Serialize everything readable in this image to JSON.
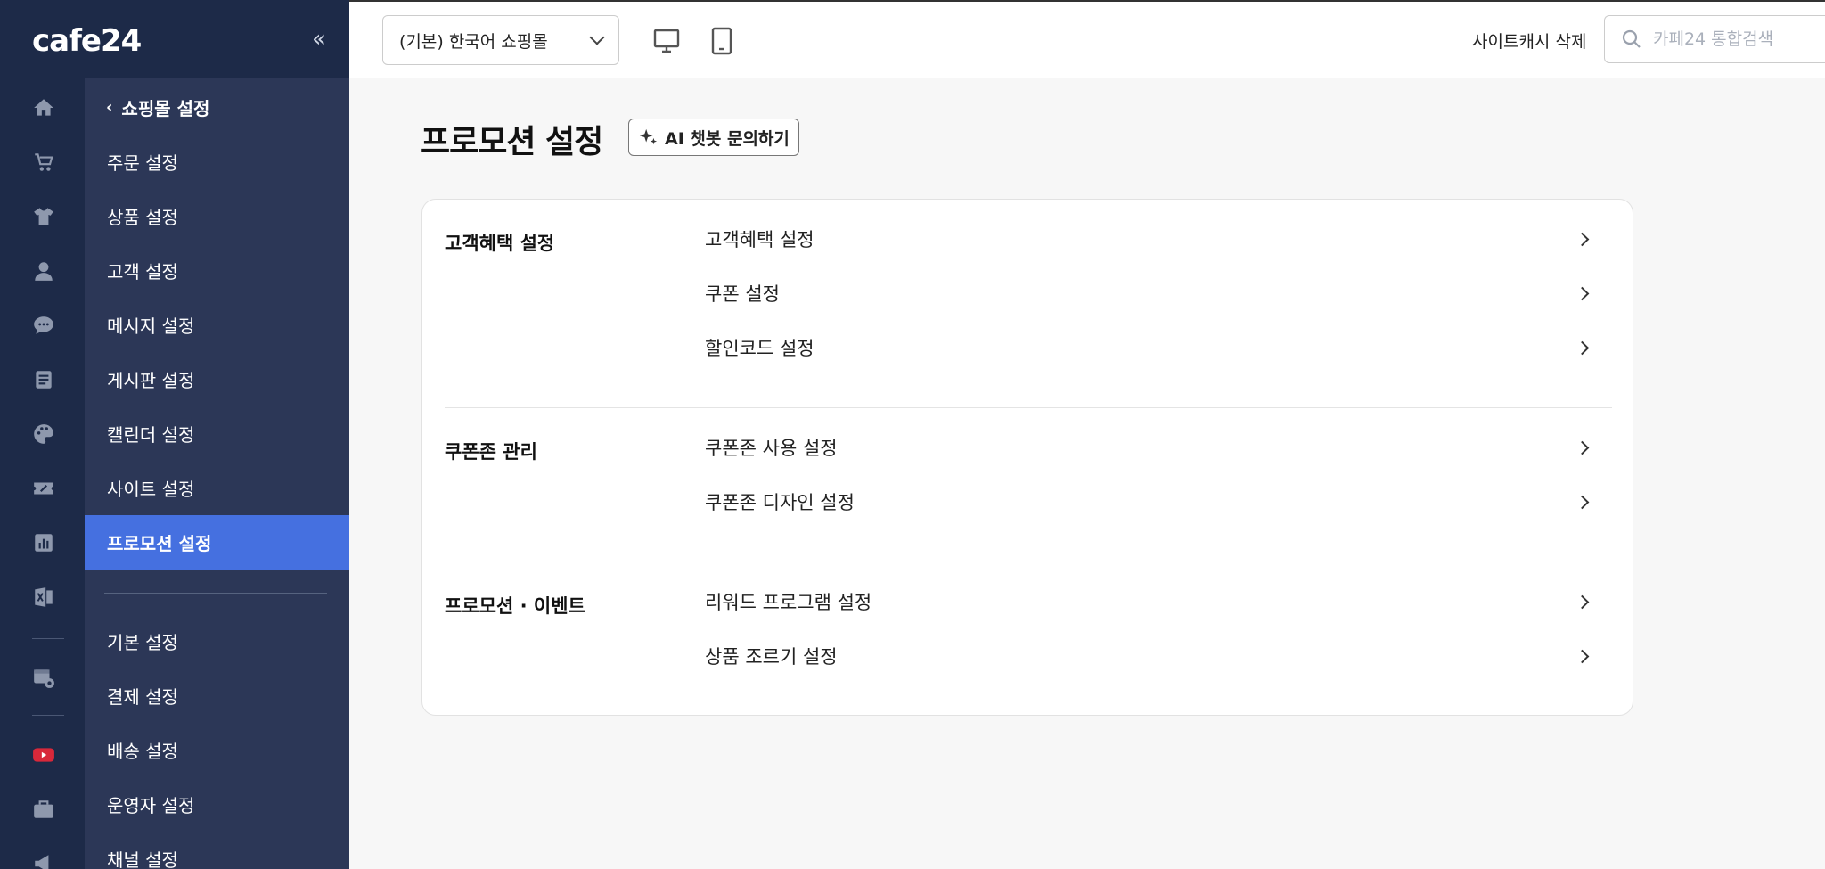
{
  "app": {
    "logo": "cafe24",
    "collapse_icon": "«"
  },
  "rail_icons": [
    "home-icon",
    "cart-icon",
    "tshirt-icon",
    "person-icon",
    "chat-icon",
    "document-icon",
    "palette-icon",
    "coupon-icon",
    "chart-icon",
    "excel-icon",
    "calendar-gear-icon",
    "youtube-icon",
    "briefcase-icon",
    "megaphone-icon"
  ],
  "submenu": {
    "back_label": "쇼핑몰 설정",
    "items": [
      {
        "label": "주문 설정"
      },
      {
        "label": "상품 설정"
      },
      {
        "label": "고객 설정"
      },
      {
        "label": "메시지 설정"
      },
      {
        "label": "게시판 설정"
      },
      {
        "label": "캘린더 설정"
      },
      {
        "label": "사이트 설정"
      },
      {
        "label": "프로모션 설정",
        "active": true
      }
    ],
    "items2": [
      {
        "label": "기본 설정"
      },
      {
        "label": "결제 설정"
      },
      {
        "label": "배송 설정"
      },
      {
        "label": "운영자 설정"
      },
      {
        "label": "채널 설정"
      }
    ]
  },
  "topbar": {
    "mall_select": "(기본) 한국어 쇼핑몰",
    "cache_delete": "사이트캐시 삭제",
    "search_placeholder": "카페24 통합검색"
  },
  "main": {
    "title": "프로모션 설정",
    "ai_button": "AI 챗봇 문의하기",
    "sections": [
      {
        "title": "고객혜택 설정",
        "links": [
          "고객혜택 설정",
          "쿠폰 설정",
          "할인코드 설정"
        ]
      },
      {
        "title": "쿠폰존 관리",
        "links": [
          "쿠폰존 사용 설정",
          "쿠폰존 디자인 설정"
        ]
      },
      {
        "title": "프로모션 · 이벤트",
        "links": [
          "리워드 프로그램 설정",
          "상품 조르기 설정"
        ]
      }
    ]
  },
  "colors": {
    "rail_bg": "#1d2a48",
    "submenu_bg": "#2c3757",
    "active_bg": "#4570e0"
  }
}
